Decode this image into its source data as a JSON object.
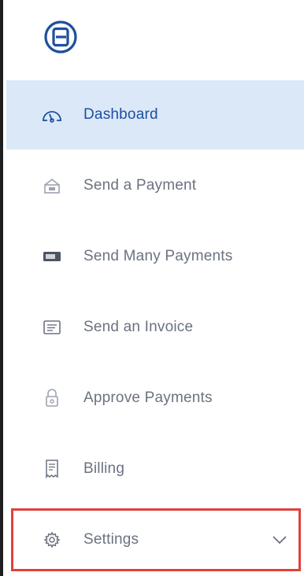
{
  "app": {
    "logo_icon": "e-logo-icon",
    "brand_color": "#1e4f9e"
  },
  "nav": {
    "items": [
      {
        "label": "Dashboard",
        "icon": "speedometer-icon",
        "active": true
      },
      {
        "label": "Send a Payment",
        "icon": "send-payment-icon",
        "active": false
      },
      {
        "label": "Send Many Payments",
        "icon": "card-stack-icon",
        "active": false
      },
      {
        "label": "Send an Invoice",
        "icon": "invoice-icon",
        "active": false
      },
      {
        "label": "Approve Payments",
        "icon": "lock-icon",
        "active": false
      },
      {
        "label": "Billing",
        "icon": "receipt-icon",
        "active": false
      },
      {
        "label": "Settings",
        "icon": "gear-icon",
        "active": false,
        "expandable": true
      }
    ]
  },
  "colors": {
    "active_bg": "#dbe8f8",
    "inactive_text": "#6b7280",
    "highlight_border": "#e0413c"
  }
}
